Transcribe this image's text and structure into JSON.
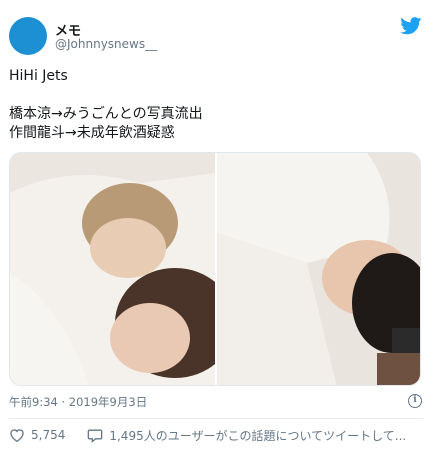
{
  "author": {
    "name": "メモ",
    "handle": "@Johnnysnews__"
  },
  "tweet": {
    "lines": [
      "HiHi Jets",
      "",
      "橋本涼→みうごんとの写真流出",
      "作間龍斗→未成年飲酒疑惑"
    ]
  },
  "media": {
    "photos": [
      {
        "description": "photo-left"
      },
      {
        "description": "photo-right"
      }
    ]
  },
  "meta": {
    "timestamp": "午前9:34 · 2019年9月3日"
  },
  "actions": {
    "likes": "5,754",
    "replies_text": "1,495人のユーザーがこの話題についてツイートして..."
  },
  "colors": {
    "avatar": "#1d8fd3",
    "twitter_blue": "#1da1f2",
    "muted": "#657786"
  },
  "icons": {
    "bird": "twitter-bird-icon",
    "info": "info-icon",
    "like": "heart-icon",
    "reply": "speech-bubble-icon"
  }
}
